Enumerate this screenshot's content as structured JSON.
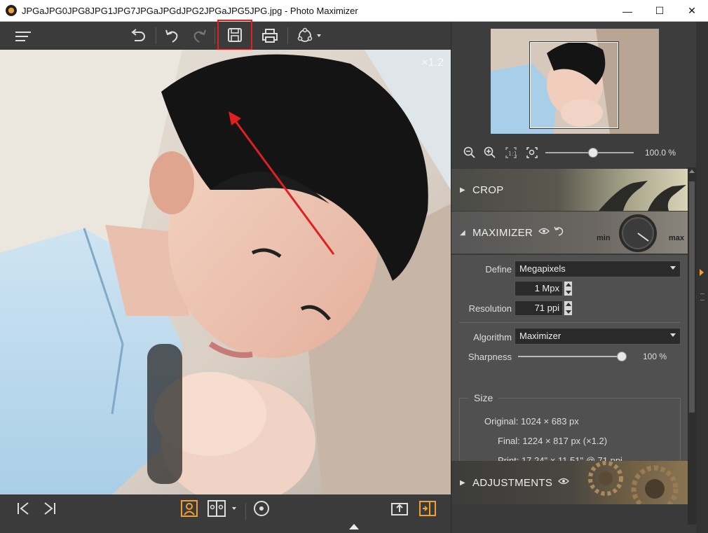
{
  "window": {
    "title": "JPGaJPG0JPG8JPG1JPG7JPGaJPGdJPG2JPGaJPG5JPG.jpg - Photo Maximizer",
    "minimize": "—",
    "maximize": "☐",
    "close": "✕"
  },
  "canvas": {
    "zoom_label": "×1.2"
  },
  "navigator": {
    "zoom_value": "100.0 %",
    "zoom_fraction": 0.54
  },
  "sections": {
    "crop": {
      "label": "CROP",
      "arrow": "▶"
    },
    "maximizer": {
      "label": "MAXIMIZER",
      "arrow": "◢",
      "dial_min": "min",
      "dial_max": "max"
    },
    "adjustments": {
      "label": "ADJUSTMENTS",
      "arrow": "▶"
    }
  },
  "maximizer": {
    "define_label": "Define",
    "define_value": "Megapixels",
    "mpx_value": "1 Mpx",
    "resolution_label": "Resolution",
    "resolution_value": "71 ppi",
    "algorithm_label": "Algorithm",
    "algorithm_value": "Maximizer",
    "sharpness_label": "Sharpness",
    "sharpness_value": "100 %",
    "sharpness_fraction": 1.0,
    "size_title": "Size",
    "original": "Original: 1024 × 683 px",
    "final": "Final: 1224 × 817 px (×1.2)",
    "print": "Print: 17.24\" × 11.51\" @ 71 ppi"
  },
  "icons": {
    "accent": "#f0a030",
    "highlight": "#e02020"
  }
}
